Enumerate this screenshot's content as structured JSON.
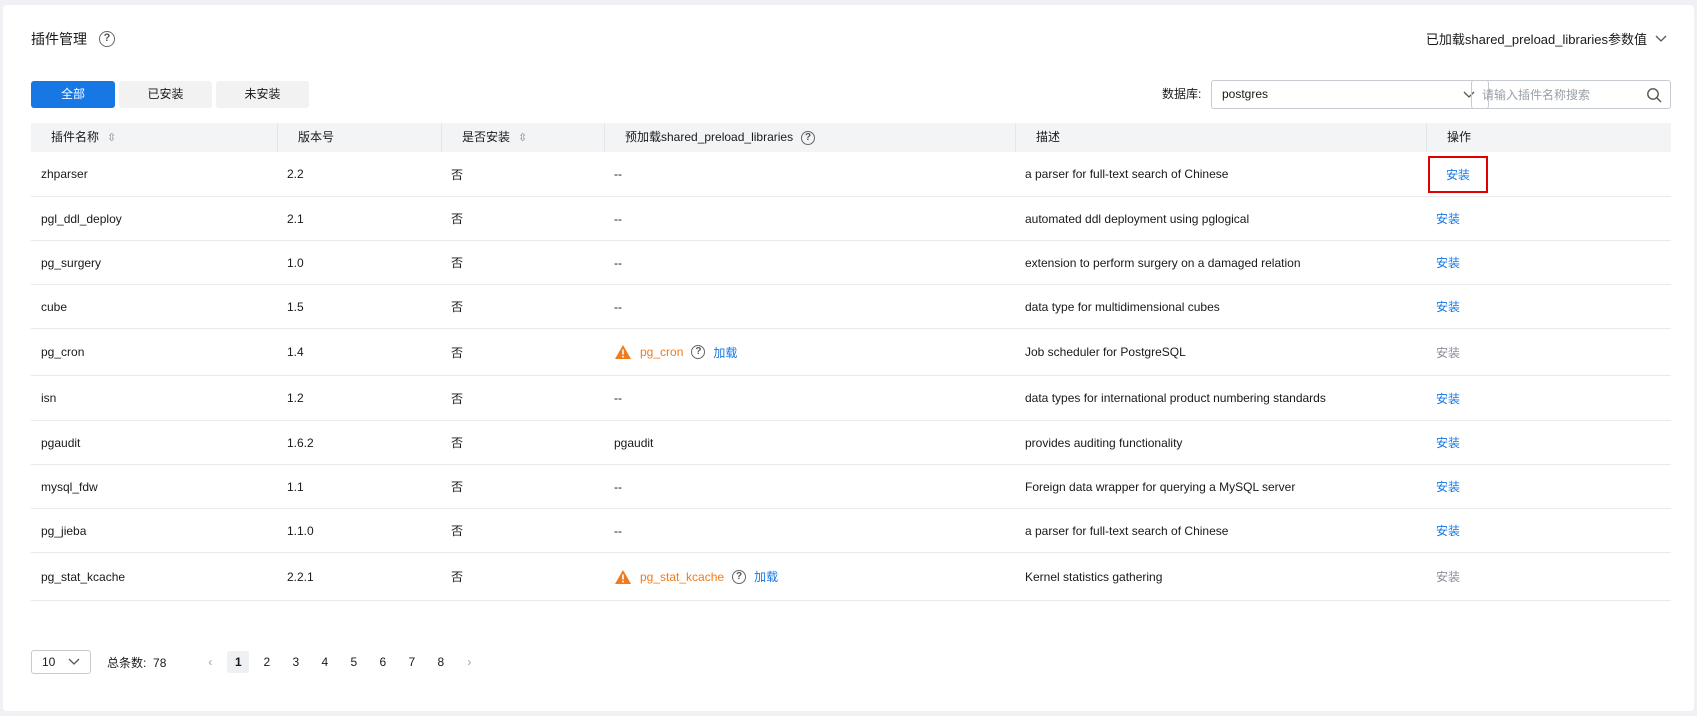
{
  "header": {
    "title": "插件管理",
    "help_icon": "?",
    "preload_dropdown_label": "已加载shared_preload_libraries参数值"
  },
  "tabs": [
    {
      "label": "全部",
      "active": true
    },
    {
      "label": "已安装",
      "active": false
    },
    {
      "label": "未安装",
      "active": false
    }
  ],
  "filters": {
    "database_label": "数据库:",
    "database_value": "postgres",
    "search_placeholder": "请输入插件名称搜索"
  },
  "table": {
    "columns": [
      "插件名称",
      "版本号",
      "是否安装",
      "预加载shared_preload_libraries",
      "描述",
      "操作"
    ],
    "rows": [
      {
        "name": "zhparser",
        "version": "2.2",
        "installed": "否",
        "preload": "--",
        "desc": "a parser for full-text search of Chinese",
        "action": "安装",
        "action_enabled": true,
        "highlighted": true
      },
      {
        "name": "pgl_ddl_deploy",
        "version": "2.1",
        "installed": "否",
        "preload": "--",
        "desc": "automated ddl deployment using pglogical",
        "action": "安装",
        "action_enabled": true
      },
      {
        "name": "pg_surgery",
        "version": "1.0",
        "installed": "否",
        "preload": "--",
        "desc": "extension to perform surgery on a damaged relation",
        "action": "安装",
        "action_enabled": true
      },
      {
        "name": "cube",
        "version": "1.5",
        "installed": "否",
        "preload": "--",
        "desc": "data type for multidimensional cubes",
        "action": "安装",
        "action_enabled": true
      },
      {
        "name": "pg_cron",
        "version": "1.4",
        "installed": "否",
        "preload": "pg_cron",
        "preload_warning": true,
        "preload_action": "加载",
        "desc": "Job scheduler for PostgreSQL",
        "action": "安装",
        "action_enabled": false
      },
      {
        "name": "isn",
        "version": "1.2",
        "installed": "否",
        "preload": "--",
        "desc": "data types for international product numbering standards",
        "action": "安装",
        "action_enabled": true
      },
      {
        "name": "pgaudit",
        "version": "1.6.2",
        "installed": "否",
        "preload": "pgaudit",
        "desc": "provides auditing functionality",
        "action": "安装",
        "action_enabled": true
      },
      {
        "name": "mysql_fdw",
        "version": "1.1",
        "installed": "否",
        "preload": "--",
        "desc": "Foreign data wrapper for querying a MySQL server",
        "action": "安装",
        "action_enabled": true
      },
      {
        "name": "pg_jieba",
        "version": "1.1.0",
        "installed": "否",
        "preload": "--",
        "desc": "a parser for full-text search of Chinese",
        "action": "安装",
        "action_enabled": true
      },
      {
        "name": "pg_stat_kcache",
        "version": "2.2.1",
        "installed": "否",
        "preload": "pg_stat_kcache",
        "preload_warning": true,
        "preload_action": "加载",
        "desc": "Kernel statistics gathering",
        "action": "安装",
        "action_enabled": false
      }
    ]
  },
  "pagination": {
    "page_size": "10",
    "total_label": "总条数:",
    "total_count": "78",
    "pages": [
      "1",
      "2",
      "3",
      "4",
      "5",
      "6",
      "7",
      "8"
    ],
    "current": "1"
  },
  "colors": {
    "primary": "#1677e5",
    "warning": "#ef7b1c",
    "highlight_border": "#e00000"
  }
}
